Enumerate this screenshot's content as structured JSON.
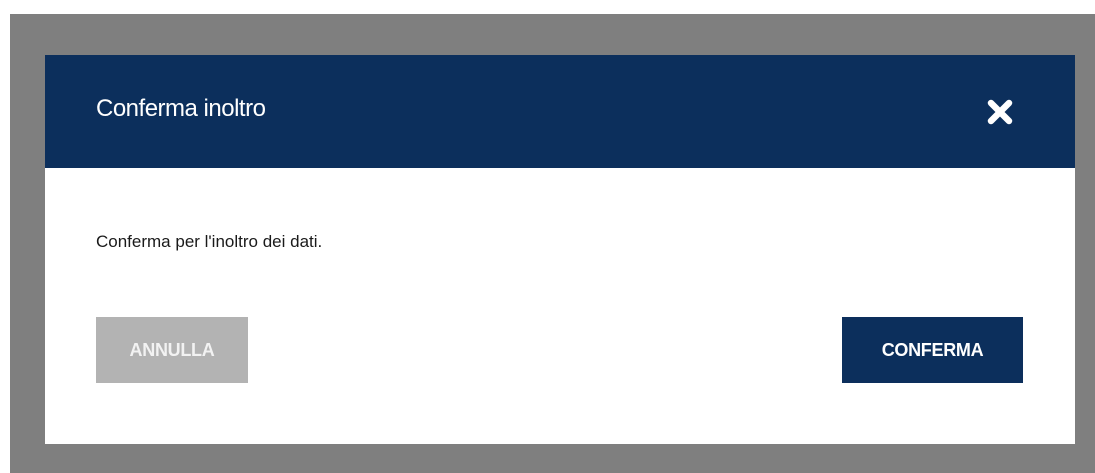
{
  "dialog": {
    "title": "Conferma inoltro",
    "close_icon": "close-icon",
    "message": "Conferma per l'inoltro dei dati.",
    "cancel_label": "ANNULLA",
    "confirm_label": "CONFERMA"
  },
  "colors": {
    "overlay": "#7f7f7f",
    "header_background": "#0c2f5c",
    "primary_button": "#0c2f5c",
    "secondary_button": "#b3b3b3"
  }
}
